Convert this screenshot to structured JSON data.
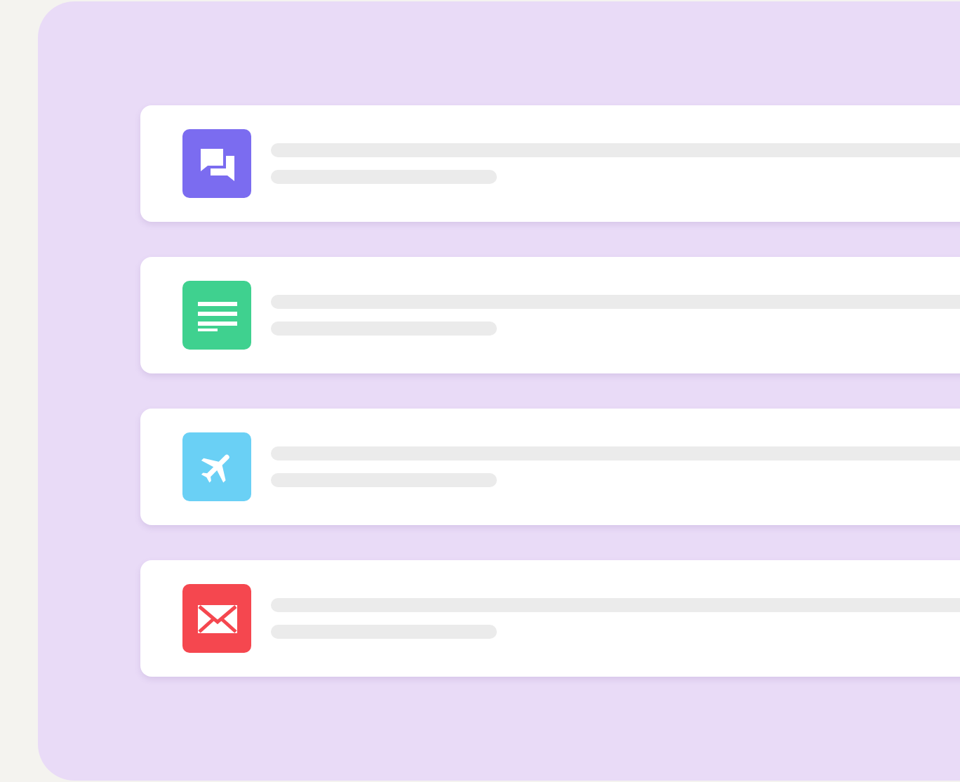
{
  "items": [
    {
      "kind": "chat",
      "color": "#7b6cf0"
    },
    {
      "kind": "document",
      "color": "#3fd18f"
    },
    {
      "kind": "plane",
      "color": "#6ad0f5"
    },
    {
      "kind": "mail",
      "color": "#f5474f"
    }
  ]
}
